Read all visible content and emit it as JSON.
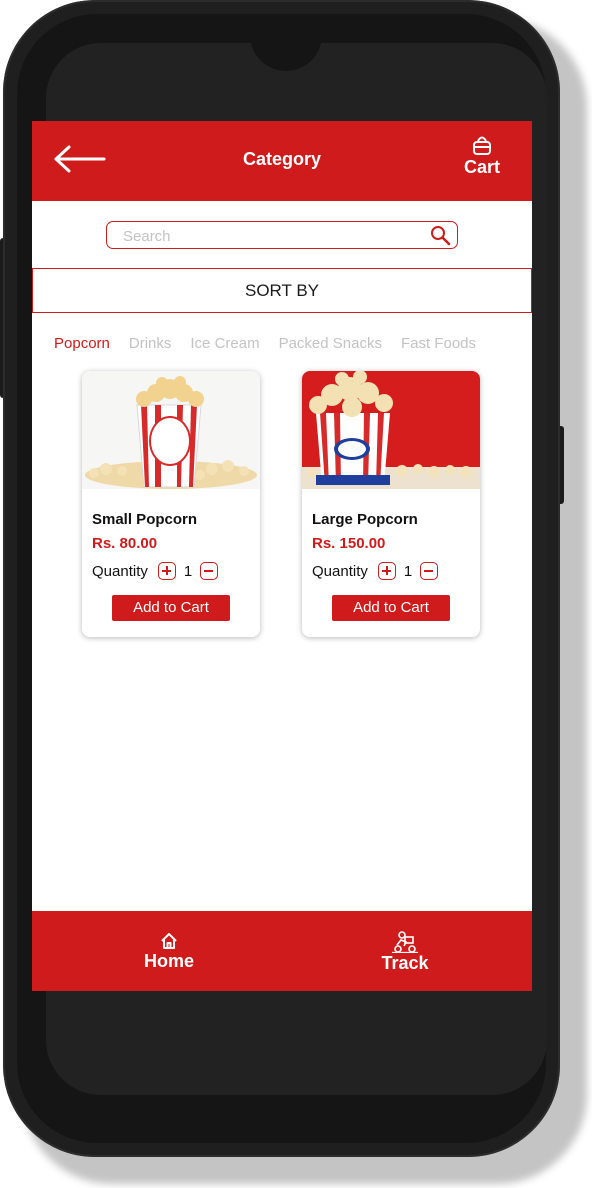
{
  "header": {
    "title": "Category",
    "cart_label": "Cart"
  },
  "search": {
    "placeholder": "Search"
  },
  "sort": {
    "label": "SORT BY"
  },
  "tabs": [
    {
      "label": "Popcorn",
      "active": true
    },
    {
      "label": "Drinks",
      "active": false
    },
    {
      "label": "Ice Cream",
      "active": false
    },
    {
      "label": "Packed Snacks",
      "active": false
    },
    {
      "label": "Fast Foods",
      "active": false
    }
  ],
  "products": [
    {
      "name": "Small Popcorn",
      "price": "Rs. 80.00",
      "quantity_label": "Quantity",
      "quantity": "1",
      "button": "Add to Cart"
    },
    {
      "name": "Large Popcorn",
      "price": "Rs. 150.00",
      "quantity_label": "Quantity",
      "quantity": "1",
      "button": "Add to Cart"
    }
  ],
  "bottom_nav": {
    "home": "Home",
    "track": "Track"
  },
  "colors": {
    "accent": "#cf1b1b",
    "inactive_tab": "#c3c3c3"
  },
  "icons": [
    "back-arrow-icon",
    "cart-icon",
    "search-icon",
    "plus-icon",
    "minus-icon",
    "home-icon",
    "track-icon"
  ]
}
